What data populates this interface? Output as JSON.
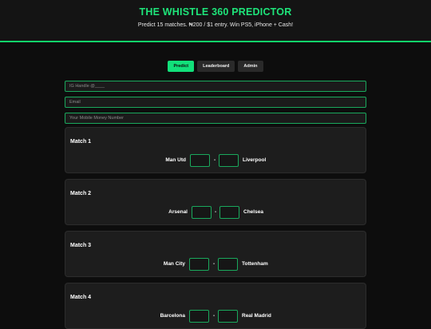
{
  "header": {
    "title": "THE WHISTLE 360 PREDICTOR",
    "subtitle": "Predict 15 matches. ₦200 / $1 entry. Win PS5, iPhone + Cash!"
  },
  "tabs": [
    {
      "label": "Predict",
      "active": true
    },
    {
      "label": "Leaderboard",
      "active": false
    },
    {
      "label": "Admin",
      "active": false
    }
  ],
  "form": {
    "ig_handle_placeholder": "IG Handle @____",
    "email_placeholder": "Email",
    "momo_placeholder": "Your Mobile Money Number"
  },
  "matches": [
    {
      "title": "Match 1",
      "home": "Man Utd",
      "away": "Liverpool",
      "separator": "-"
    },
    {
      "title": "Match 2",
      "home": "Arsenal",
      "away": "Chelsea",
      "separator": "-"
    },
    {
      "title": "Match 3",
      "home": "Man City",
      "away": "Tottenham",
      "separator": "-"
    },
    {
      "title": "Match 4",
      "home": "Barcelona",
      "away": "Real Madrid",
      "separator": "-"
    }
  ],
  "colors": {
    "accent": "#12e07a",
    "background": "#0d0d0d",
    "card": "#1d1d1d",
    "border": "#1aa85c"
  }
}
